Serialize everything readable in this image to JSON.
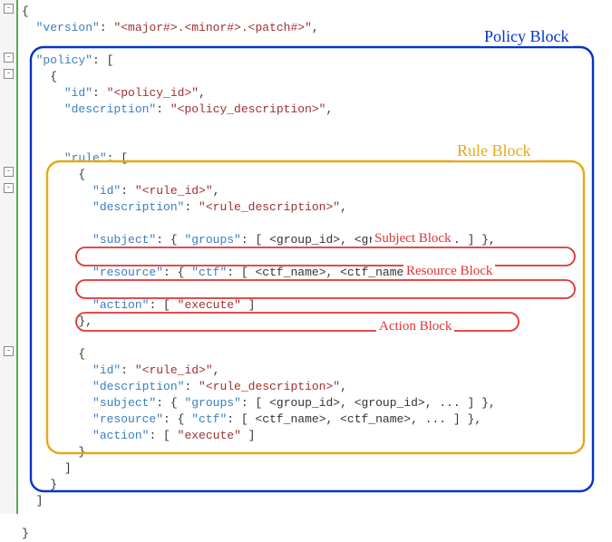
{
  "code": {
    "version_key": "\"version\"",
    "version_val": "\"<major#>.<minor#>.<patch#>\"",
    "policy_key": "\"policy\"",
    "id_key": "\"id\"",
    "policy_id_val": "\"<policy_id>\"",
    "desc_key": "\"description\"",
    "policy_desc_val": "\"<policy_description>\"",
    "rule_key": "\"rule\"",
    "rule_id_val": "\"<rule_id>\"",
    "rule_desc_val": "\"<rule_description>\"",
    "subject_key": "\"subject\"",
    "groups_key": "\"groups\"",
    "group_list": "[ <group_id>, <group_id>, ... ]",
    "resource_key": "\"resource\"",
    "ctf_key": "\"ctf\"",
    "ctf_list": "[ <ctf_name>, <ctf_name>, ... ]",
    "action_key": "\"action\"",
    "action_list": "[ ",
    "execute_val": "\"execute\"",
    "action_close": " ]"
  },
  "annotations": {
    "policy_block": "Policy Block",
    "rule_block": "Rule Block",
    "subject_block": "Subject Block",
    "resource_block": "Resource Block",
    "action_block": "Action Block"
  },
  "colors": {
    "policy": "#0033cc",
    "rule": "#e6a817",
    "sub": "#e03333"
  }
}
